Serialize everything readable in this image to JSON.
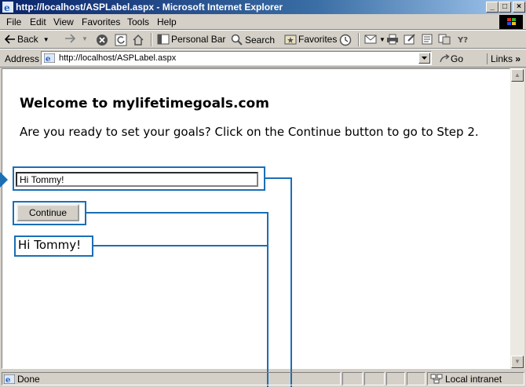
{
  "window": {
    "title": "http://localhost/ASPLabel.aspx - Microsoft Internet Explorer",
    "minimize": "_",
    "maximize": "□",
    "close": "×"
  },
  "menu": [
    "File",
    "Edit",
    "View",
    "Favorites",
    "Tools",
    "Help"
  ],
  "toolbar": {
    "back": "Back",
    "personal_bar": "Personal Bar",
    "search": "Search",
    "favorites": "Favorites"
  },
  "address": {
    "label": "Address",
    "url": "http://localhost/ASPLabel.aspx",
    "go": "Go",
    "links": "Links"
  },
  "page": {
    "heading": "Welcome to mylifetimegoals.com",
    "intro": "Are you ready to set your goals? Click on the Continue button to go to Step 2.",
    "input_value": "Hi Tommy!",
    "continue_label": "Continue",
    "result_label": "Hi Tommy!"
  },
  "status": {
    "text": "Done",
    "zone": "Local intranet"
  },
  "colors": {
    "callout": "#1a6fb5",
    "titlebar": "#0a246a"
  }
}
